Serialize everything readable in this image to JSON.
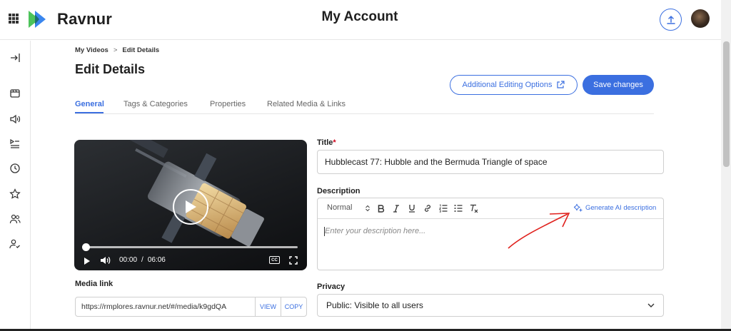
{
  "app": {
    "name": "Ravnur",
    "page_title": "My Account"
  },
  "breadcrumb": {
    "items": [
      "My Videos",
      "Edit Details"
    ],
    "separator": ">"
  },
  "header": {
    "title": "Edit Details",
    "additional_label": "Additional Editing Options",
    "save_label": "Save changes"
  },
  "tabs": [
    {
      "label": "General",
      "active": true
    },
    {
      "label": "Tags & Categories",
      "active": false
    },
    {
      "label": "Properties",
      "active": false
    },
    {
      "label": "Related Media & Links",
      "active": false
    }
  ],
  "video": {
    "current_time": "00:00",
    "separator": "/",
    "duration": "06:06",
    "progress": 0
  },
  "title_field": {
    "label": "Title",
    "required_mark": "*",
    "value": "Hubblecast 77: Hubble and the Bermuda Triangle of space"
  },
  "description": {
    "label": "Description",
    "format": "Normal",
    "generate_ai_label": "Generate AI description",
    "placeholder": "Enter your description here..."
  },
  "media_link": {
    "label": "Media link",
    "url": "https://rmplores.ravnur.net/#/media/k9gdQA",
    "view_label": "VIEW",
    "copy_label": "COPY"
  },
  "privacy": {
    "label": "Privacy",
    "value": "Public: Visible to all users"
  },
  "colors": {
    "accent": "#3b6fe0",
    "annotation": "#e0221e",
    "logo_green": "#4cc35a",
    "logo_blue": "#2f80ed"
  },
  "sidebar": {
    "icons": [
      "collapse-icon",
      "media-icon",
      "audio-icon",
      "playlist-icon",
      "history-icon",
      "favorites-icon",
      "groups-icon",
      "user-check-icon"
    ]
  }
}
